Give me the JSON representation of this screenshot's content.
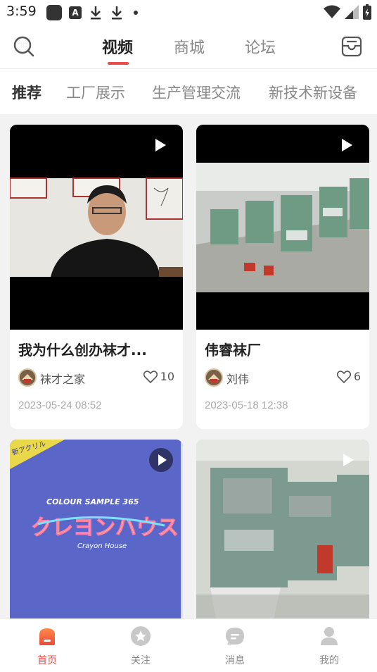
{
  "status_bar": {
    "time": "3:59",
    "a_badge": "A"
  },
  "top_nav": {
    "tabs": [
      {
        "label": "视频",
        "active": true
      },
      {
        "label": "商城",
        "active": false
      },
      {
        "label": "论坛",
        "active": false
      }
    ]
  },
  "categories": [
    {
      "label": "推荐",
      "active": true
    },
    {
      "label": "工厂展示",
      "active": false
    },
    {
      "label": "生产管理交流",
      "active": false
    },
    {
      "label": "新技术新设备",
      "active": false
    }
  ],
  "cards": [
    {
      "title": "我为什么创办袜才...",
      "author": "袜才之家",
      "likes": "10",
      "date": "2023-05-24 08:52"
    },
    {
      "title": "伟睿袜厂",
      "author": "刘伟",
      "likes": "6",
      "date": "2023-05-18 12:38"
    },
    {
      "thumb_text_1": "COLOUR SAMPLE 365",
      "thumb_text_2": "クレヨンハウス",
      "thumb_text_3": "Crayon House",
      "thumb_text_4": "新アクリル"
    },
    {}
  ],
  "bottom_nav": [
    {
      "label": "首页",
      "icon": "home-icon",
      "active": true
    },
    {
      "label": "关注",
      "icon": "star-icon",
      "active": false
    },
    {
      "label": "消息",
      "icon": "chat-icon",
      "active": false
    },
    {
      "label": "我的",
      "icon": "user-icon",
      "active": false
    }
  ],
  "colors": {
    "accent": "#e94f4a"
  }
}
